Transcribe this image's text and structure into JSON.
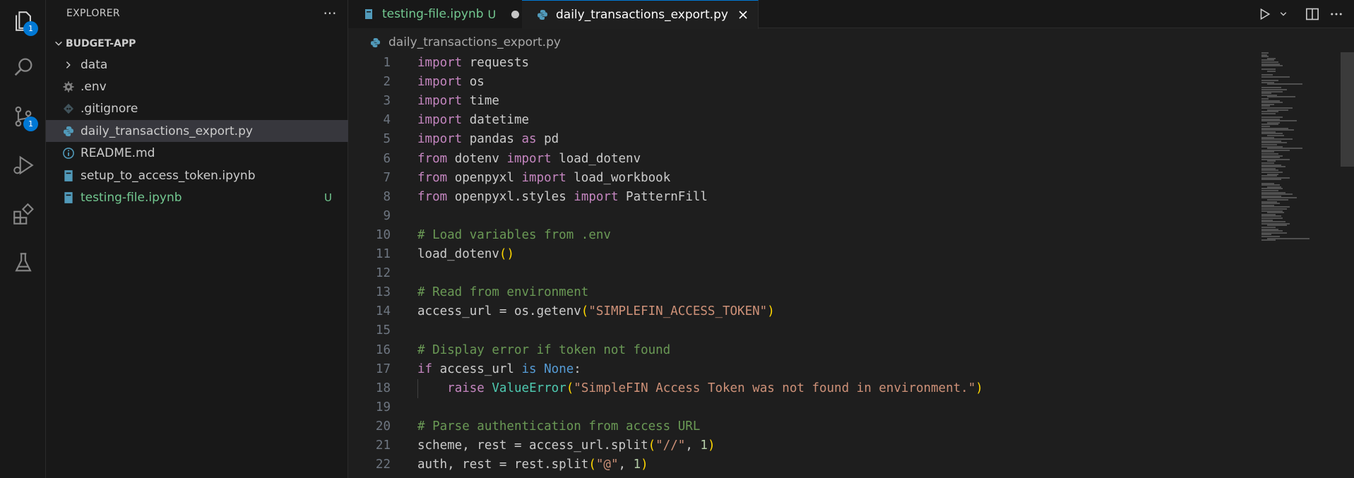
{
  "activity_bar": {
    "items": [
      {
        "icon": "files-icon",
        "badge": "1"
      },
      {
        "icon": "search-icon",
        "badge": ""
      },
      {
        "icon": "source-control-icon",
        "badge": "1"
      },
      {
        "icon": "run-debug-icon",
        "badge": ""
      },
      {
        "icon": "extensions-icon",
        "badge": ""
      },
      {
        "icon": "testing-flask-icon",
        "badge": ""
      }
    ]
  },
  "sidebar": {
    "title": "EXPLORER",
    "more_label": "···",
    "folder": "BUDGET-APP",
    "items": [
      {
        "name": "data",
        "icon": "chevron-right-icon",
        "status": ""
      },
      {
        "name": ".env",
        "icon": "gear-icon",
        "status": ""
      },
      {
        "name": ".gitignore",
        "icon": "git-diamond-icon",
        "status": ""
      },
      {
        "name": "daily_transactions_export.py",
        "icon": "python-icon",
        "status": ""
      },
      {
        "name": "README.md",
        "icon": "info-icon",
        "status": ""
      },
      {
        "name": "setup_to_access_token.ipynb",
        "icon": "notebook-icon",
        "status": ""
      },
      {
        "name": "testing-file.ipynb",
        "icon": "notebook-icon",
        "status": "U"
      }
    ]
  },
  "tabs": [
    {
      "label": "testing-file.ipynb",
      "status": "U",
      "active": false
    },
    {
      "label": "daily_transactions_export.py",
      "status": "",
      "active": true
    }
  ],
  "breadcrumb": {
    "file": "daily_transactions_export.py"
  },
  "colors": {
    "accent": "#0078d4",
    "untracked": "#73c991",
    "keyword": "#c586c0",
    "string": "#ce9178",
    "comment": "#6a9955",
    "number": "#b5cea8",
    "class": "#4ec9b0",
    "constant": "#569cd6",
    "bracket": "#ffd700"
  },
  "code_lines": [
    {
      "n": "1",
      "t": [
        [
          "kw",
          "import"
        ],
        [
          "plain",
          " requests"
        ]
      ]
    },
    {
      "n": "2",
      "t": [
        [
          "kw",
          "import"
        ],
        [
          "plain",
          " os"
        ]
      ]
    },
    {
      "n": "3",
      "t": [
        [
          "kw",
          "import"
        ],
        [
          "plain",
          " time"
        ]
      ]
    },
    {
      "n": "4",
      "t": [
        [
          "kw",
          "import"
        ],
        [
          "plain",
          " datetime"
        ]
      ]
    },
    {
      "n": "5",
      "t": [
        [
          "kw",
          "import"
        ],
        [
          "plain",
          " pandas "
        ],
        [
          "kw",
          "as"
        ],
        [
          "plain",
          " pd"
        ]
      ]
    },
    {
      "n": "6",
      "t": [
        [
          "kw",
          "from"
        ],
        [
          "plain",
          " dotenv "
        ],
        [
          "kw",
          "import"
        ],
        [
          "plain",
          " load_dotenv"
        ]
      ]
    },
    {
      "n": "7",
      "t": [
        [
          "kw",
          "from"
        ],
        [
          "plain",
          " openpyxl "
        ],
        [
          "kw",
          "import"
        ],
        [
          "plain",
          " load_workbook"
        ]
      ]
    },
    {
      "n": "8",
      "t": [
        [
          "kw",
          "from"
        ],
        [
          "plain",
          " openpyxl.styles "
        ],
        [
          "kw",
          "import"
        ],
        [
          "plain",
          " PatternFill"
        ]
      ]
    },
    {
      "n": "9",
      "t": []
    },
    {
      "n": "10",
      "t": [
        [
          "cmt",
          "# Load variables from .env"
        ]
      ]
    },
    {
      "n": "11",
      "t": [
        [
          "plain",
          "load_dotenv"
        ],
        [
          "paren",
          "()"
        ]
      ]
    },
    {
      "n": "12",
      "t": []
    },
    {
      "n": "13",
      "t": [
        [
          "cmt",
          "# Read from environment"
        ]
      ]
    },
    {
      "n": "14",
      "t": [
        [
          "plain",
          "access_url = os.getenv"
        ],
        [
          "paren",
          "("
        ],
        [
          "str",
          "\"SIMPLEFIN_ACCESS_TOKEN\""
        ],
        [
          "paren",
          ")"
        ]
      ]
    },
    {
      "n": "15",
      "t": []
    },
    {
      "n": "16",
      "t": [
        [
          "cmt",
          "# Display error if token not found"
        ]
      ]
    },
    {
      "n": "17",
      "t": [
        [
          "kw",
          "if"
        ],
        [
          "plain",
          " access_url "
        ],
        [
          "const",
          "is"
        ],
        [
          "plain",
          " "
        ],
        [
          "const",
          "None"
        ],
        [
          "plain",
          ":"
        ]
      ]
    },
    {
      "n": "18",
      "indent": true,
      "t": [
        [
          "plain",
          "    "
        ],
        [
          "kw",
          "raise"
        ],
        [
          "plain",
          " "
        ],
        [
          "cls",
          "ValueError"
        ],
        [
          "paren",
          "("
        ],
        [
          "str",
          "\"SimpleFIN Access Token was not found in environment.\""
        ],
        [
          "paren",
          ")"
        ]
      ]
    },
    {
      "n": "19",
      "t": []
    },
    {
      "n": "20",
      "t": [
        [
          "cmt",
          "# Parse authentication from access URL"
        ]
      ]
    },
    {
      "n": "21",
      "t": [
        [
          "plain",
          "scheme, rest = access_url.split"
        ],
        [
          "paren",
          "("
        ],
        [
          "str",
          "\"//\""
        ],
        [
          "plain",
          ", "
        ],
        [
          "num",
          "1"
        ],
        [
          "paren",
          ")"
        ]
      ]
    },
    {
      "n": "22",
      "t": [
        [
          "plain",
          "auth, rest = rest.split"
        ],
        [
          "paren",
          "("
        ],
        [
          "str",
          "\"@\""
        ],
        [
          "plain",
          ", "
        ],
        [
          "num",
          "1"
        ],
        [
          "paren",
          ")"
        ]
      ]
    }
  ]
}
